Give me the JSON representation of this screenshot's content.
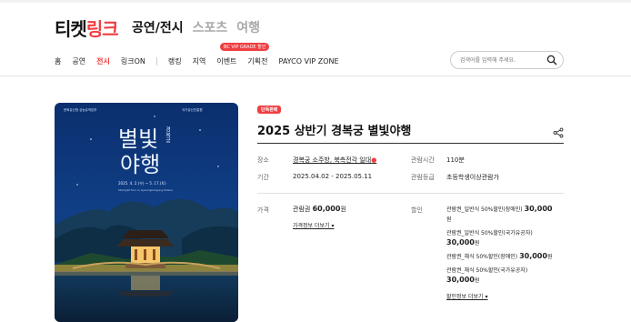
{
  "header": {
    "logo_black": "티켓",
    "logo_red": "링크",
    "gnb": [
      "공연/전시",
      "스포츠",
      "여행"
    ]
  },
  "subnav": {
    "badge": "BC VIP GRADE 할인",
    "items": [
      "홈",
      "공연",
      "전시",
      "링크ON",
      "랭킹",
      "지역",
      "이벤트",
      "기획전",
      "PAYCO VIP ZONE"
    ],
    "active_index": 2
  },
  "search": {
    "placeholder": "검색어를 입력해 주세요."
  },
  "poster": {
    "title_line1": "별빛",
    "title_line2": "야행",
    "vertical": "경복궁",
    "dates": "2025. 4. 2.(수) ~ 5. 17.(토)",
    "subtitle": "Starlight Tour in Gyeongbokgung Palace",
    "org_left": "문화유산청 궁능유적본부",
    "org_right": "국가유산진흥원"
  },
  "product": {
    "tag": "단독판매",
    "title": "2025 상반기 경복궁 별빛야행",
    "place_label": "장소",
    "place_value": "경복궁 소주방, 북측전각 일대",
    "runtime_label": "관람시간",
    "runtime_value": "110분",
    "period_label": "기간",
    "period_value": "2025.04.02 - 2025.05.11",
    "age_label": "관람등급",
    "age_value": "초등학생이상관람가",
    "price_label": "가격",
    "price_name": "관람권",
    "price_amount": "60,000",
    "price_unit": "원",
    "price_more": "가격정보 더보기",
    "discount_label": "할인",
    "discounts": [
      {
        "name": "관람권_일반식 50%할인(장애인)",
        "amount": "30,000",
        "unit": "원"
      },
      {
        "name": "관람권_일반식 50%할인(국가유공자)",
        "amount": "30,000",
        "unit": "원"
      },
      {
        "name": "관람권_채식 50%할인(장애인)",
        "amount": "30,000",
        "unit": "원"
      },
      {
        "name": "관람권_채식 50%할인(국가유공자)",
        "amount": "30,000",
        "unit": "원"
      }
    ],
    "discount_more": "할인정보 더보기"
  }
}
